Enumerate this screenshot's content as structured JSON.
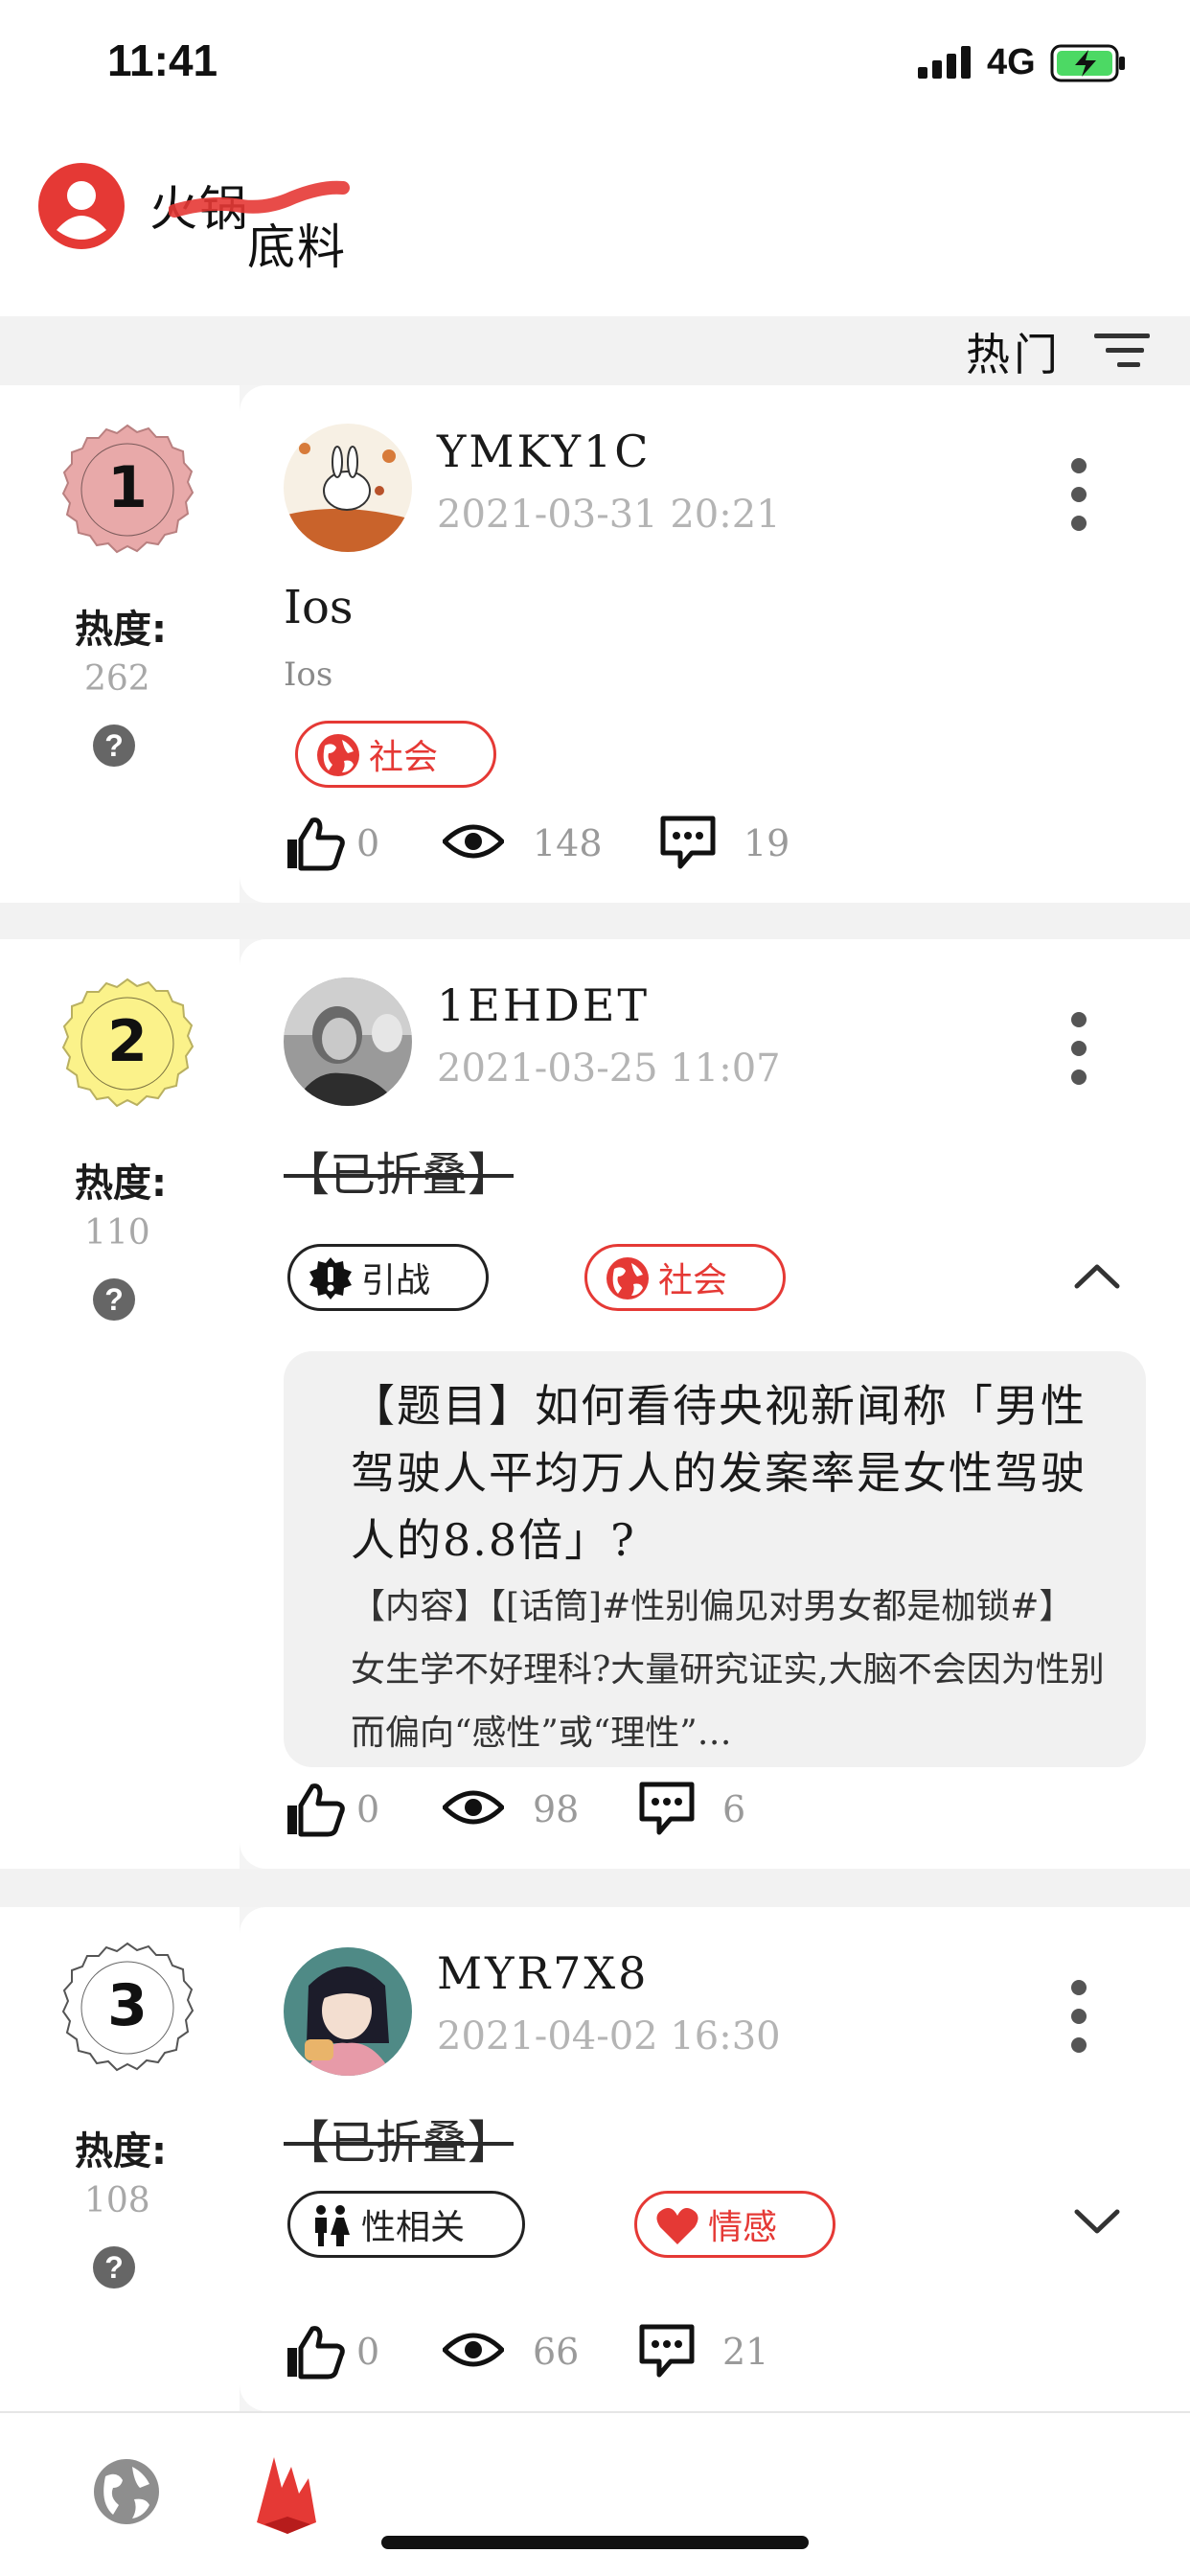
{
  "status_bar": {
    "time": "11:41",
    "network": "4G"
  },
  "header": {
    "brand_part1": "火锅",
    "brand_part2": "底料"
  },
  "sort": {
    "label": "热门"
  },
  "heat_label": "热度:",
  "colors": {
    "accent": "#e53935",
    "rank1": "#e8a9a9",
    "rank2": "#fbf28a",
    "rank3": "#ffffff",
    "muted": "#a8a8a8"
  },
  "posts": [
    {
      "rank": "1",
      "heat": "262",
      "author": "YMKY1C",
      "time": "2021-03-31 20:21",
      "title": "Ios",
      "subtitle": "Ios",
      "tags": [
        {
          "label": "社会",
          "icon": "globe-icon"
        }
      ],
      "likes": "0",
      "views": "148",
      "comments": "19"
    },
    {
      "rank": "2",
      "heat": "110",
      "author": "1EHDET",
      "time": "2021-03-25 11:07",
      "title": "【已折叠】",
      "tags": [
        {
          "label": "引战",
          "icon": "alert-badge-icon"
        },
        {
          "label": "社会",
          "icon": "globe-icon"
        }
      ],
      "quote_title": "【题目】如何看待央视新闻称「男性驾驶人平均万人的发案率是女性驾驶人的8.8倍」?",
      "quote_body": "【内容】【[话筒]#性别偏见对男女都是枷锁#】女生学不好理科?大量研究证实,大脑不会因为性别而偏向“感性”或“理性”…",
      "likes": "0",
      "views": "98",
      "comments": "6"
    },
    {
      "rank": "3",
      "heat": "108",
      "author": "MYR7X8",
      "time": "2021-04-02 16:30",
      "title": "【已折叠】",
      "tags": [
        {
          "label": "性相关",
          "icon": "couple-icon"
        },
        {
          "label": "情感",
          "icon": "heart-icon"
        }
      ],
      "likes": "0",
      "views": "66",
      "comments": "21"
    }
  ]
}
